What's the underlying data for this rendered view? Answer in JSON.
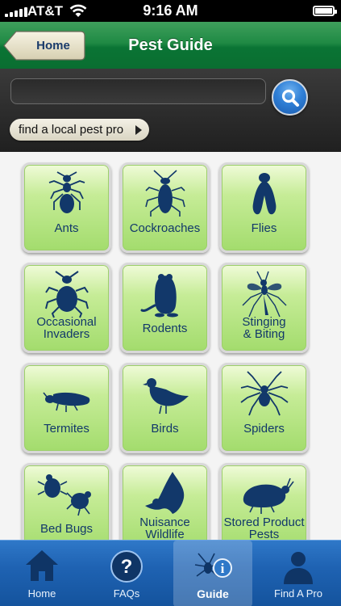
{
  "status_bar": {
    "carrier": "AT&T",
    "time": "9:16 AM"
  },
  "nav": {
    "back_label": "Home",
    "title": "Pest Guide"
  },
  "search": {
    "value": "",
    "placeholder": "",
    "pro_label": "find a local pest pro"
  },
  "categories": [
    {
      "label": "Ants",
      "icon": "ant-icon"
    },
    {
      "label": "Cockroaches",
      "icon": "cockroach-icon"
    },
    {
      "label": "Flies",
      "icon": "fly-icon"
    },
    {
      "label_line1": "Occasional",
      "label_line2": "Invaders",
      "icon": "beetle-icon"
    },
    {
      "label": "Rodents",
      "icon": "rodent-icon"
    },
    {
      "label_line1": "Stinging",
      "label_line2": "& Biting",
      "icon": "mosquito-icon"
    },
    {
      "label": "Termites",
      "icon": "termite-icon"
    },
    {
      "label": "Birds",
      "icon": "pigeon-icon"
    },
    {
      "label": "Spiders",
      "icon": "spider-icon"
    },
    {
      "label": "Bed Bugs",
      "icon": "bed-bug-icon"
    },
    {
      "label_line1": "Nuisance",
      "label_line2": "Wildlife",
      "icon": "bat-icon"
    },
    {
      "label_line1": "Stored Product",
      "label_line2": "Pests",
      "icon": "weevil-icon"
    }
  ],
  "tabs": [
    {
      "label": "Home",
      "icon": "house-icon"
    },
    {
      "label": "FAQs",
      "icon": "question-icon"
    },
    {
      "label": "Guide",
      "icon": "spider-info-icon",
      "active": true
    },
    {
      "label": "Find A Pro",
      "icon": "person-icon"
    }
  ],
  "colors": {
    "nav_green": "#0a7434",
    "tile_green": "#a3dc6d",
    "pest_navy": "#12386a",
    "tab_blue": "#1f63b3"
  }
}
